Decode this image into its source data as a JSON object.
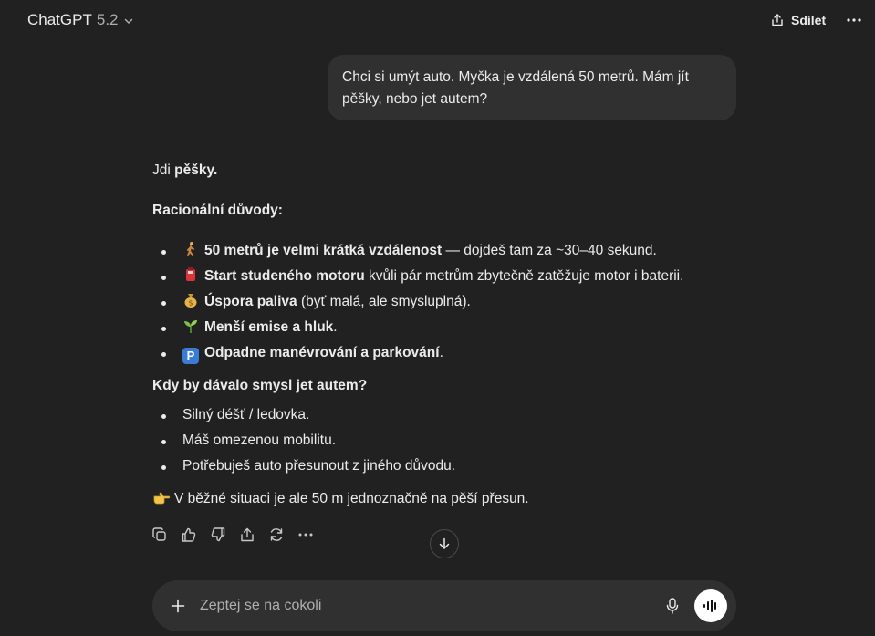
{
  "header": {
    "model_name": "ChatGPT",
    "model_version": "5.2",
    "share_label": "Sdílet"
  },
  "user_message": "Chci si umýt auto. Myčka je vzdálená 50 metrů. Mám jít pěšky, nebo jet autem?",
  "answer": {
    "intro_prefix": "Jdi ",
    "intro_bold": "pěšky",
    "intro_suffix": ".",
    "reasons_heading": "Racionální důvody:",
    "reasons": [
      {
        "icon": "walking-person-emoji",
        "bold": "50 metrů je velmi krátká vzdálenost",
        "rest": " — dojdeš tam za ~30–40 sekund."
      },
      {
        "icon": "red-pump-emoji",
        "bold": "Start studeného motoru",
        "rest": " kvůli pár metrům zbytečně zatěžuje motor i baterii."
      },
      {
        "icon": "money-bag-emoji",
        "bold": "Úspora paliva",
        "rest": " (byť malá, ale smysluplná)."
      },
      {
        "icon": "seedling-emoji",
        "bold": "Menší emise a hluk",
        "rest": "."
      },
      {
        "icon": "parking-emoji",
        "bold": "Odpadne manévrování a parkování",
        "rest": "."
      }
    ],
    "parking_glyph": "P",
    "car_heading": "Kdy by dávalo smysl jet autem?",
    "car_cases": [
      "Silný déšť / ledovka.",
      "Máš omezenou mobilitu.",
      "Potřebuješ auto přesunout z jiného důvodu."
    ],
    "conclusion_icon": "pointing-hand-emoji",
    "conclusion": "V běžné situaci je ale 50 m jednoznačně na pěší přesun."
  },
  "composer": {
    "placeholder": "Zeptej se na cokoli"
  },
  "colors": {
    "background": "#212121",
    "bubble": "#303030",
    "text": "#ececec",
    "muted": "#afafaf"
  }
}
